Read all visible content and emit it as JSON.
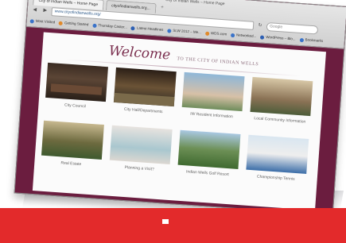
{
  "browser": {
    "window_title": "City of Indian Wells – Home Page",
    "tabs": [
      {
        "label": "City of Indian Wells – Home Page"
      },
      {
        "label": "cityofindianwells.org..."
      }
    ],
    "url": "www.cityofindianwells.org/",
    "search_placeholder": "Google",
    "bookmarks": [
      "Most Visited",
      "Getting Started",
      "Thursday Caster...",
      "Latest Headlines",
      "SLW 2012 – Me...",
      "WDS.com",
      "Networked...",
      "WordPress – Blo...",
      "Bookmarks"
    ]
  },
  "page": {
    "welcome": "Welcome",
    "welcome_sub": "TO THE CITY OF INDIAN WELLS",
    "cards": [
      {
        "label": "City Council",
        "icon": "council-photo"
      },
      {
        "label": "City Hall/Departments",
        "icon": "city-hall-photo"
      },
      {
        "label": "IW Resident Information",
        "icon": "residents-photo"
      },
      {
        "label": "Local Community Information",
        "icon": "community-photo"
      },
      {
        "label": "Real Estate",
        "icon": "real-estate-photo"
      },
      {
        "label": "Planning a Visit?",
        "icon": "spa-photo"
      },
      {
        "label": "Indian Wells Golf Resort",
        "icon": "golf-photo"
      },
      {
        "label": "Championship Tennis",
        "icon": "tennis-photo"
      }
    ]
  },
  "colors": {
    "page_background": "#6b1d3f",
    "accent_red": "#e32a2b",
    "welcome_text": "#7a2e4e"
  }
}
